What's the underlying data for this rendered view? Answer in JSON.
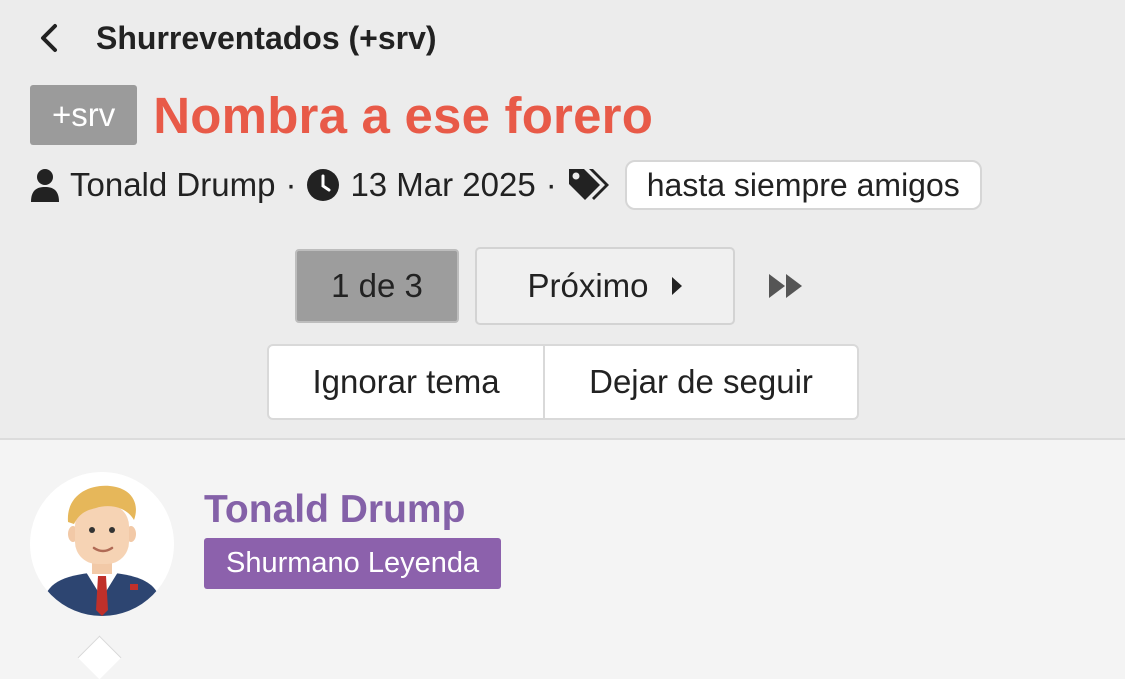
{
  "header": {
    "back_icon": "chevron-left-icon",
    "forum_name": "Shurreventados (+srv)"
  },
  "thread": {
    "prefix": "+srv",
    "title": "Nombra a ese forero",
    "title_color": "#e85a48",
    "author_icon": "user-icon",
    "author": "Tonald Drump",
    "separator": "·",
    "date_icon": "clock-icon",
    "date": "13 Mar 2025",
    "tags_icon": "tags-icon",
    "tag": "hasta siempre amigos"
  },
  "pagination": {
    "current": "1 de 3",
    "next_label": "Próximo",
    "next_icon": "caret-right-icon",
    "last_icon": "fast-forward-icon"
  },
  "actions": {
    "ignore_label": "Ignorar tema",
    "unfollow_label": "Dejar de seguir"
  },
  "post": {
    "author": "Tonald Drump",
    "author_color": "#8461a8",
    "user_title": "Shurmano Leyenda",
    "user_title_bg": "#8c61ac"
  }
}
